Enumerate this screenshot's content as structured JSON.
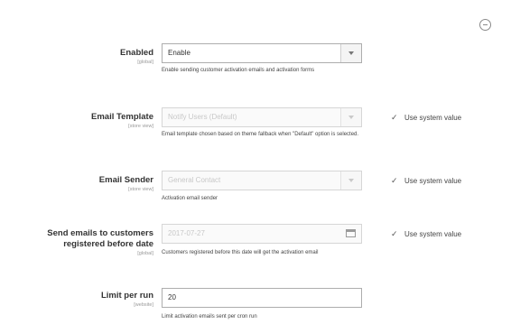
{
  "fields": {
    "enabled": {
      "label": "Enabled",
      "scope": "[global]",
      "value": "Enable",
      "note": "Enable sending customer activation emails and activation forms"
    },
    "email_template": {
      "label": "Email Template",
      "scope": "[store view]",
      "value": "Notify Users (Default)",
      "note": "Email template chosen based on theme fallback when \"Default\" option is selected.",
      "use_system": "Use system value"
    },
    "email_sender": {
      "label": "Email Sender",
      "scope": "[store view]",
      "value": "General Contact",
      "note": "Activation email sender",
      "use_system": "Use system value"
    },
    "send_before_date": {
      "label_line1": "Send emails to customers",
      "label_line2": "registered before date",
      "scope": "[global]",
      "value": "2017-07-27",
      "note": "Customers registered before this date will get the activation email",
      "use_system": "Use system value"
    },
    "limit_per_run": {
      "label": "Limit per run",
      "scope": "[website]",
      "value": "20",
      "note": "Limit activation emails sent per cron run"
    }
  },
  "icons": {
    "collapse": "collapse-circle-icon",
    "checkbox": "checkbox-checked-icon",
    "calendar": "calendar-icon",
    "dropdown": "chevron-down-icon"
  }
}
